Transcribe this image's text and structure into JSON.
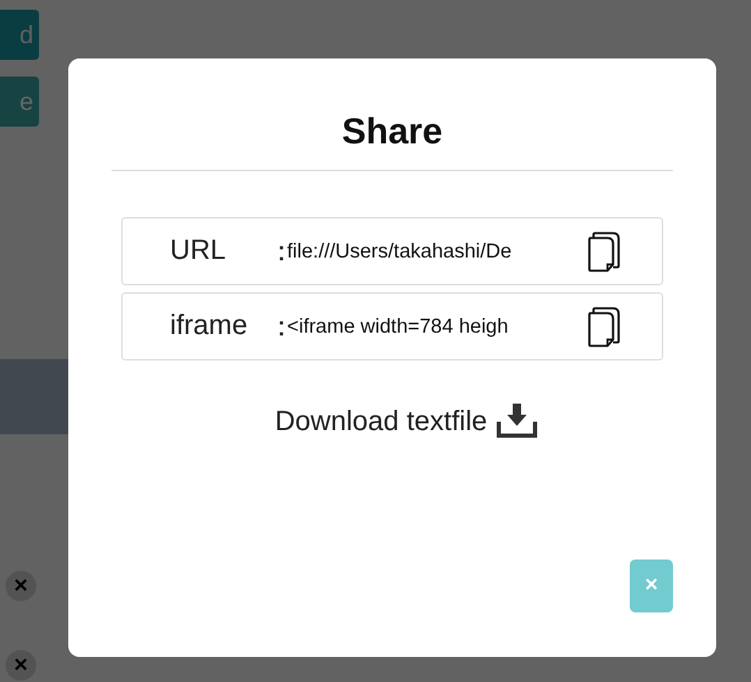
{
  "background": {
    "buttons": [
      {
        "label": "d"
      },
      {
        "label": "e"
      }
    ],
    "remove_badges": [
      {
        "label": "×"
      },
      {
        "label": "×"
      }
    ]
  },
  "dialog": {
    "title": "Share",
    "fields": [
      {
        "label": "URL",
        "separator": "：",
        "value": "file:///Users/takahashi/De"
      },
      {
        "label": "iframe",
        "separator": "：",
        "value": "<iframe width=784 heigh"
      }
    ],
    "download_link": "Download textfile",
    "close_button": "×"
  }
}
